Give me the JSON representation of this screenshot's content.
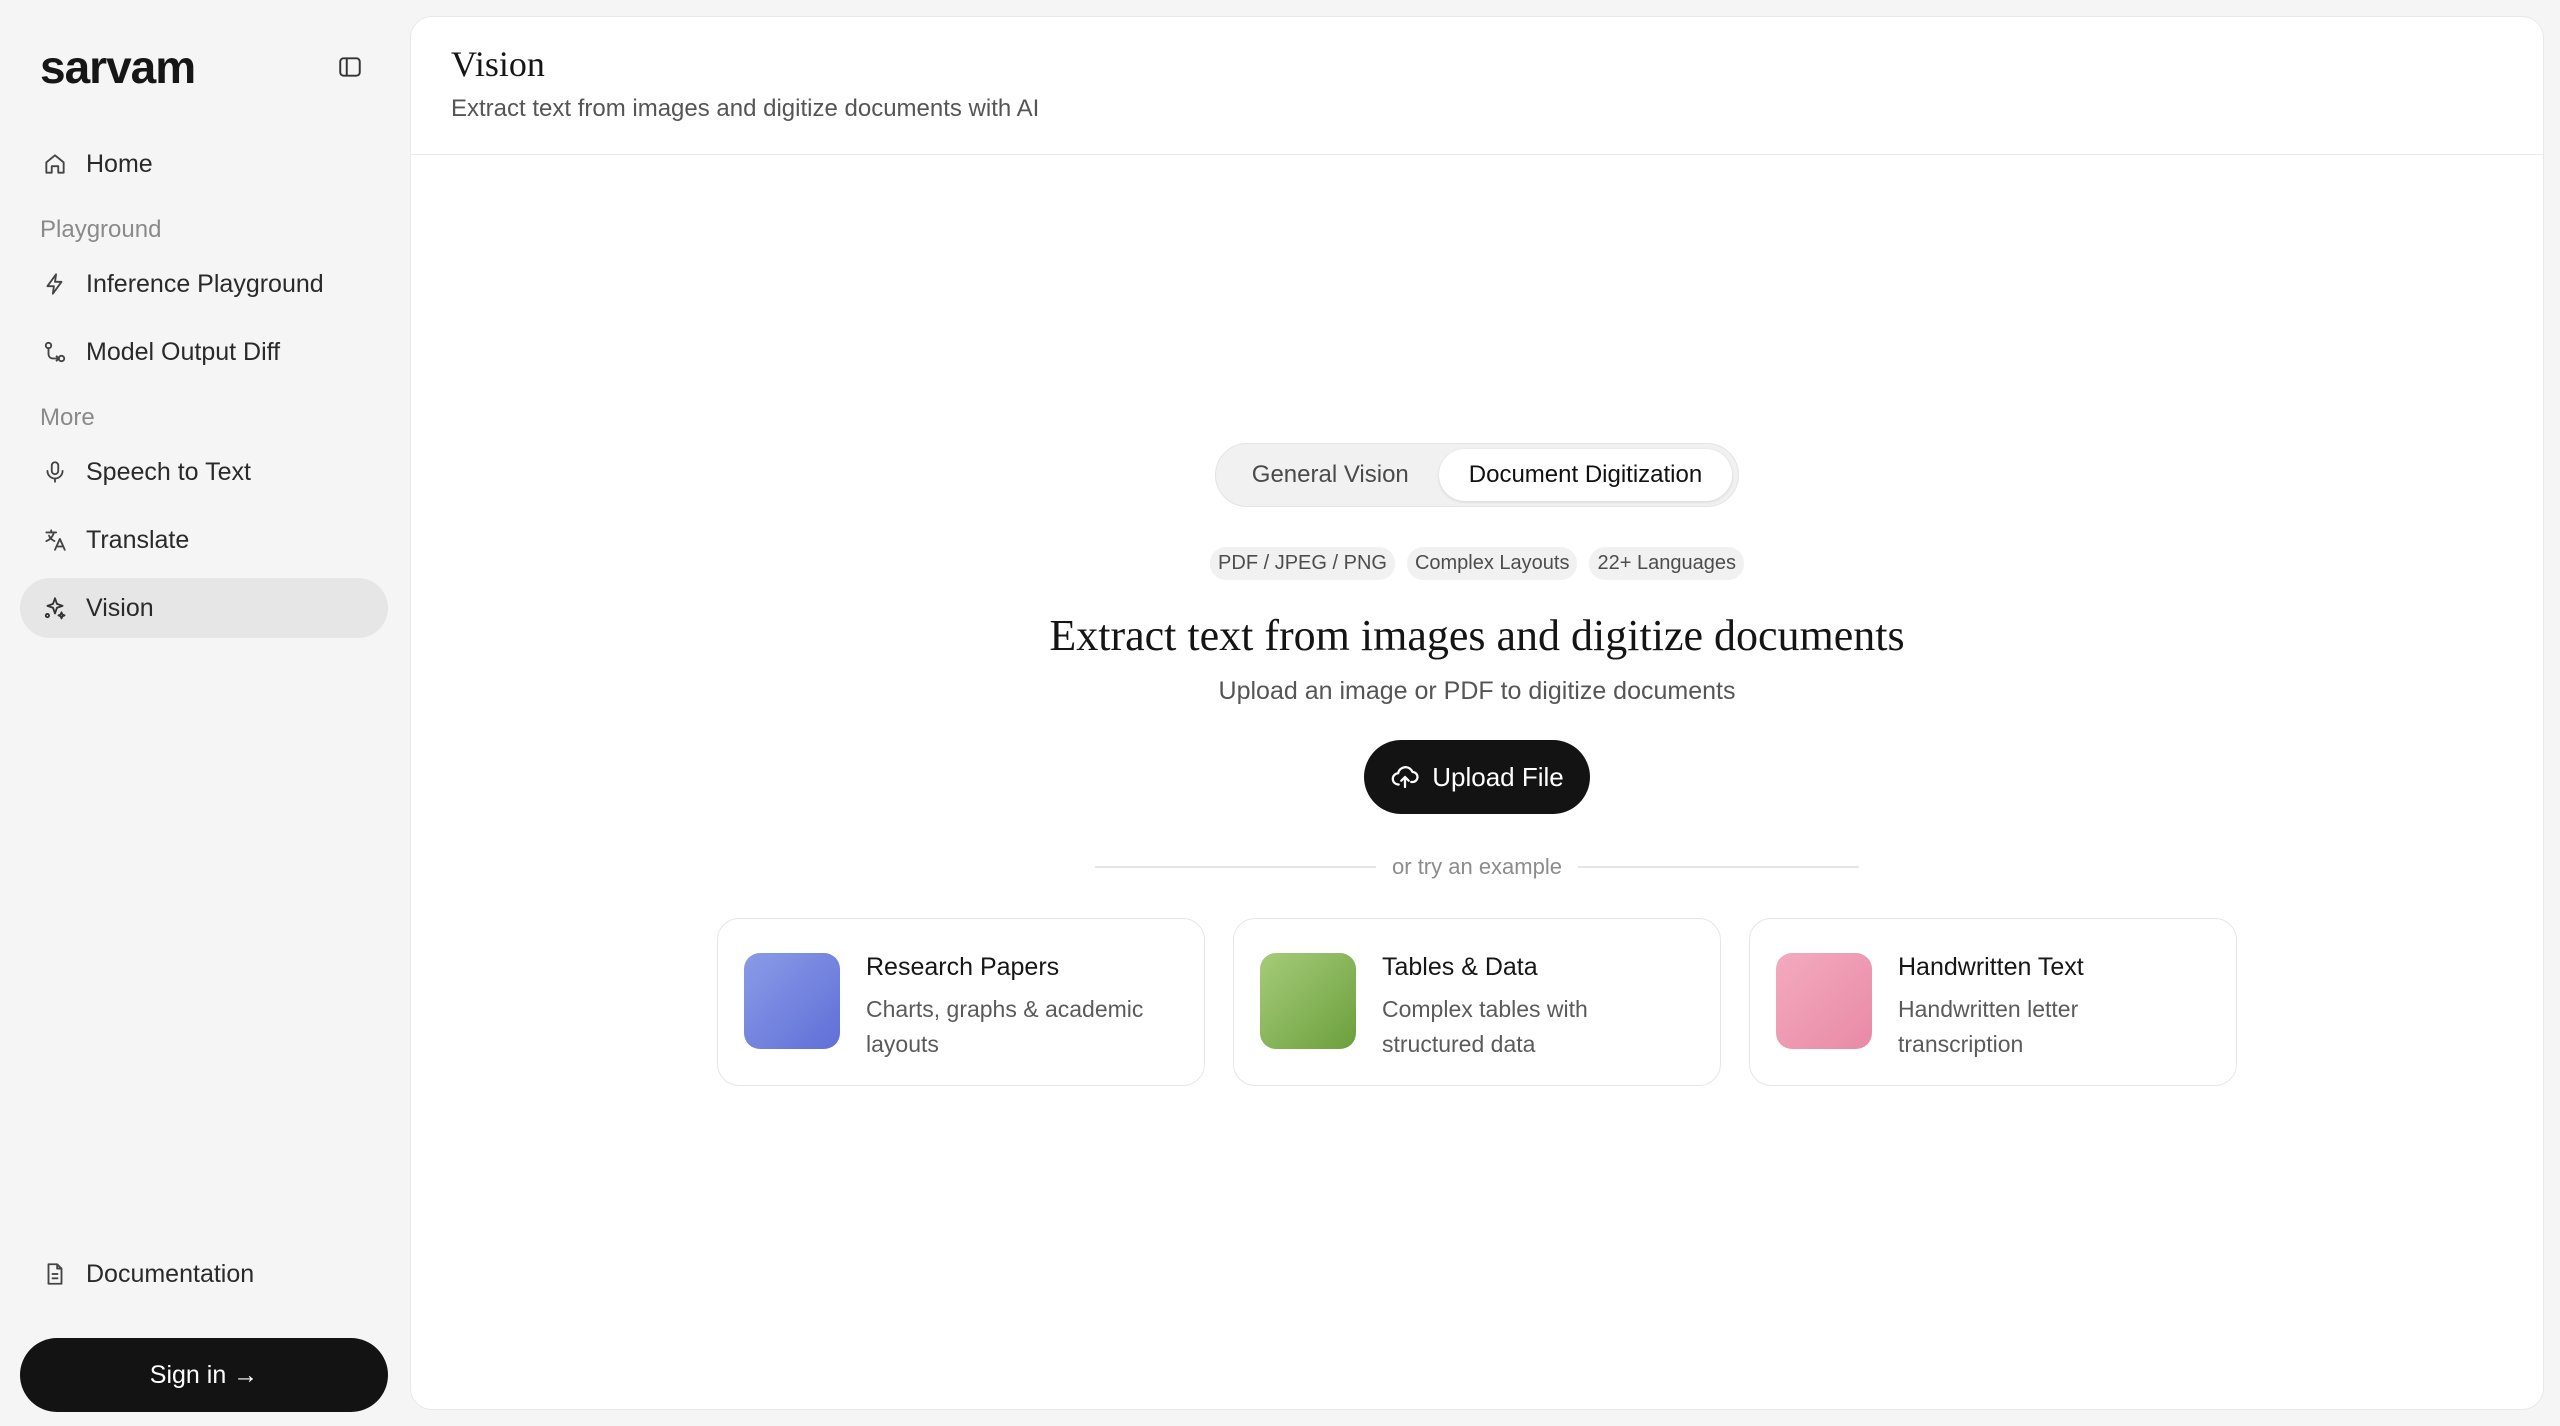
{
  "brand": {
    "logo": "sarvam"
  },
  "sidebar": {
    "home": "Home",
    "playground_label": "Playground",
    "playground_items": [
      "Inference Playground",
      "Model Output Diff"
    ],
    "more_label": "More",
    "more_items": [
      "Speech to Text",
      "Translate",
      "Vision"
    ],
    "active_item": "Vision",
    "documentation": "Documentation",
    "sign_in": "Sign in →"
  },
  "header": {
    "title": "Vision",
    "subtitle": "Extract text from images and digitize documents with AI"
  },
  "main": {
    "tabs": [
      {
        "label": "General Vision",
        "active": false
      },
      {
        "label": "Document Digitization",
        "active": true
      }
    ],
    "chips": [
      "PDF / JPEG / PNG",
      "Complex Layouts",
      "22+ Languages"
    ],
    "headline": "Extract text from images and digitize documents",
    "subline": "Upload an image or PDF to digitize documents",
    "upload_label": "Upload File",
    "divider_text": "or try an example",
    "examples": [
      {
        "title": "Research Papers",
        "desc": "Charts, graphs & academic layouts",
        "colors": [
          "#8b9be8",
          "#5f6fd6"
        ]
      },
      {
        "title": "Tables & Data",
        "desc": "Complex tables with structured data",
        "colors": [
          "#a6cc7a",
          "#6b9f3c"
        ]
      },
      {
        "title": "Handwritten Text",
        "desc": "Handwritten letter transcription",
        "colors": [
          "#f3aabf",
          "#e98aa5"
        ]
      }
    ]
  },
  "icons": {
    "sidebar_toggle": "sidebar-toggle-icon",
    "home": "home-icon",
    "inference": "lightning-icon",
    "diff": "git-diff-icon",
    "speech": "microphone-icon",
    "translate": "translate-icon",
    "vision": "sparkles-icon",
    "documentation": "document-icon",
    "upload": "cloud-upload-icon"
  }
}
